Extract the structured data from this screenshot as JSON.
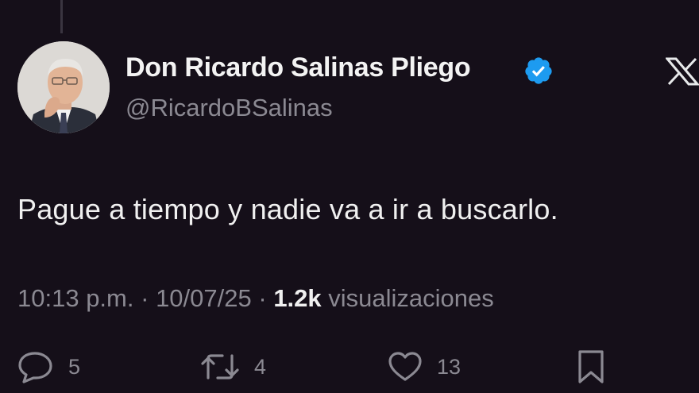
{
  "author": {
    "display_name": "Don Ricardo Salinas Pliego",
    "handle": "@RicardoBSalinas",
    "verified": true,
    "verified_color": "#1d9bf0"
  },
  "tweet": {
    "text": "Pague a tiempo y nadie va a ir a buscarlo.",
    "time": "10:13 p.m.",
    "separator": "·",
    "date": "10/07/25",
    "views_count": "1.2k",
    "views_label": "visualizaciones"
  },
  "actions": {
    "reply_count": "5",
    "retweet_count": "4",
    "like_count": "13"
  },
  "icons": [
    "x-logo-icon",
    "verified-badge-icon",
    "reply-icon",
    "retweet-icon",
    "like-icon",
    "bookmark-icon"
  ],
  "colors": {
    "background": "#150f19",
    "primary_text": "#e7e9ea",
    "secondary_text": "#8b8992"
  }
}
